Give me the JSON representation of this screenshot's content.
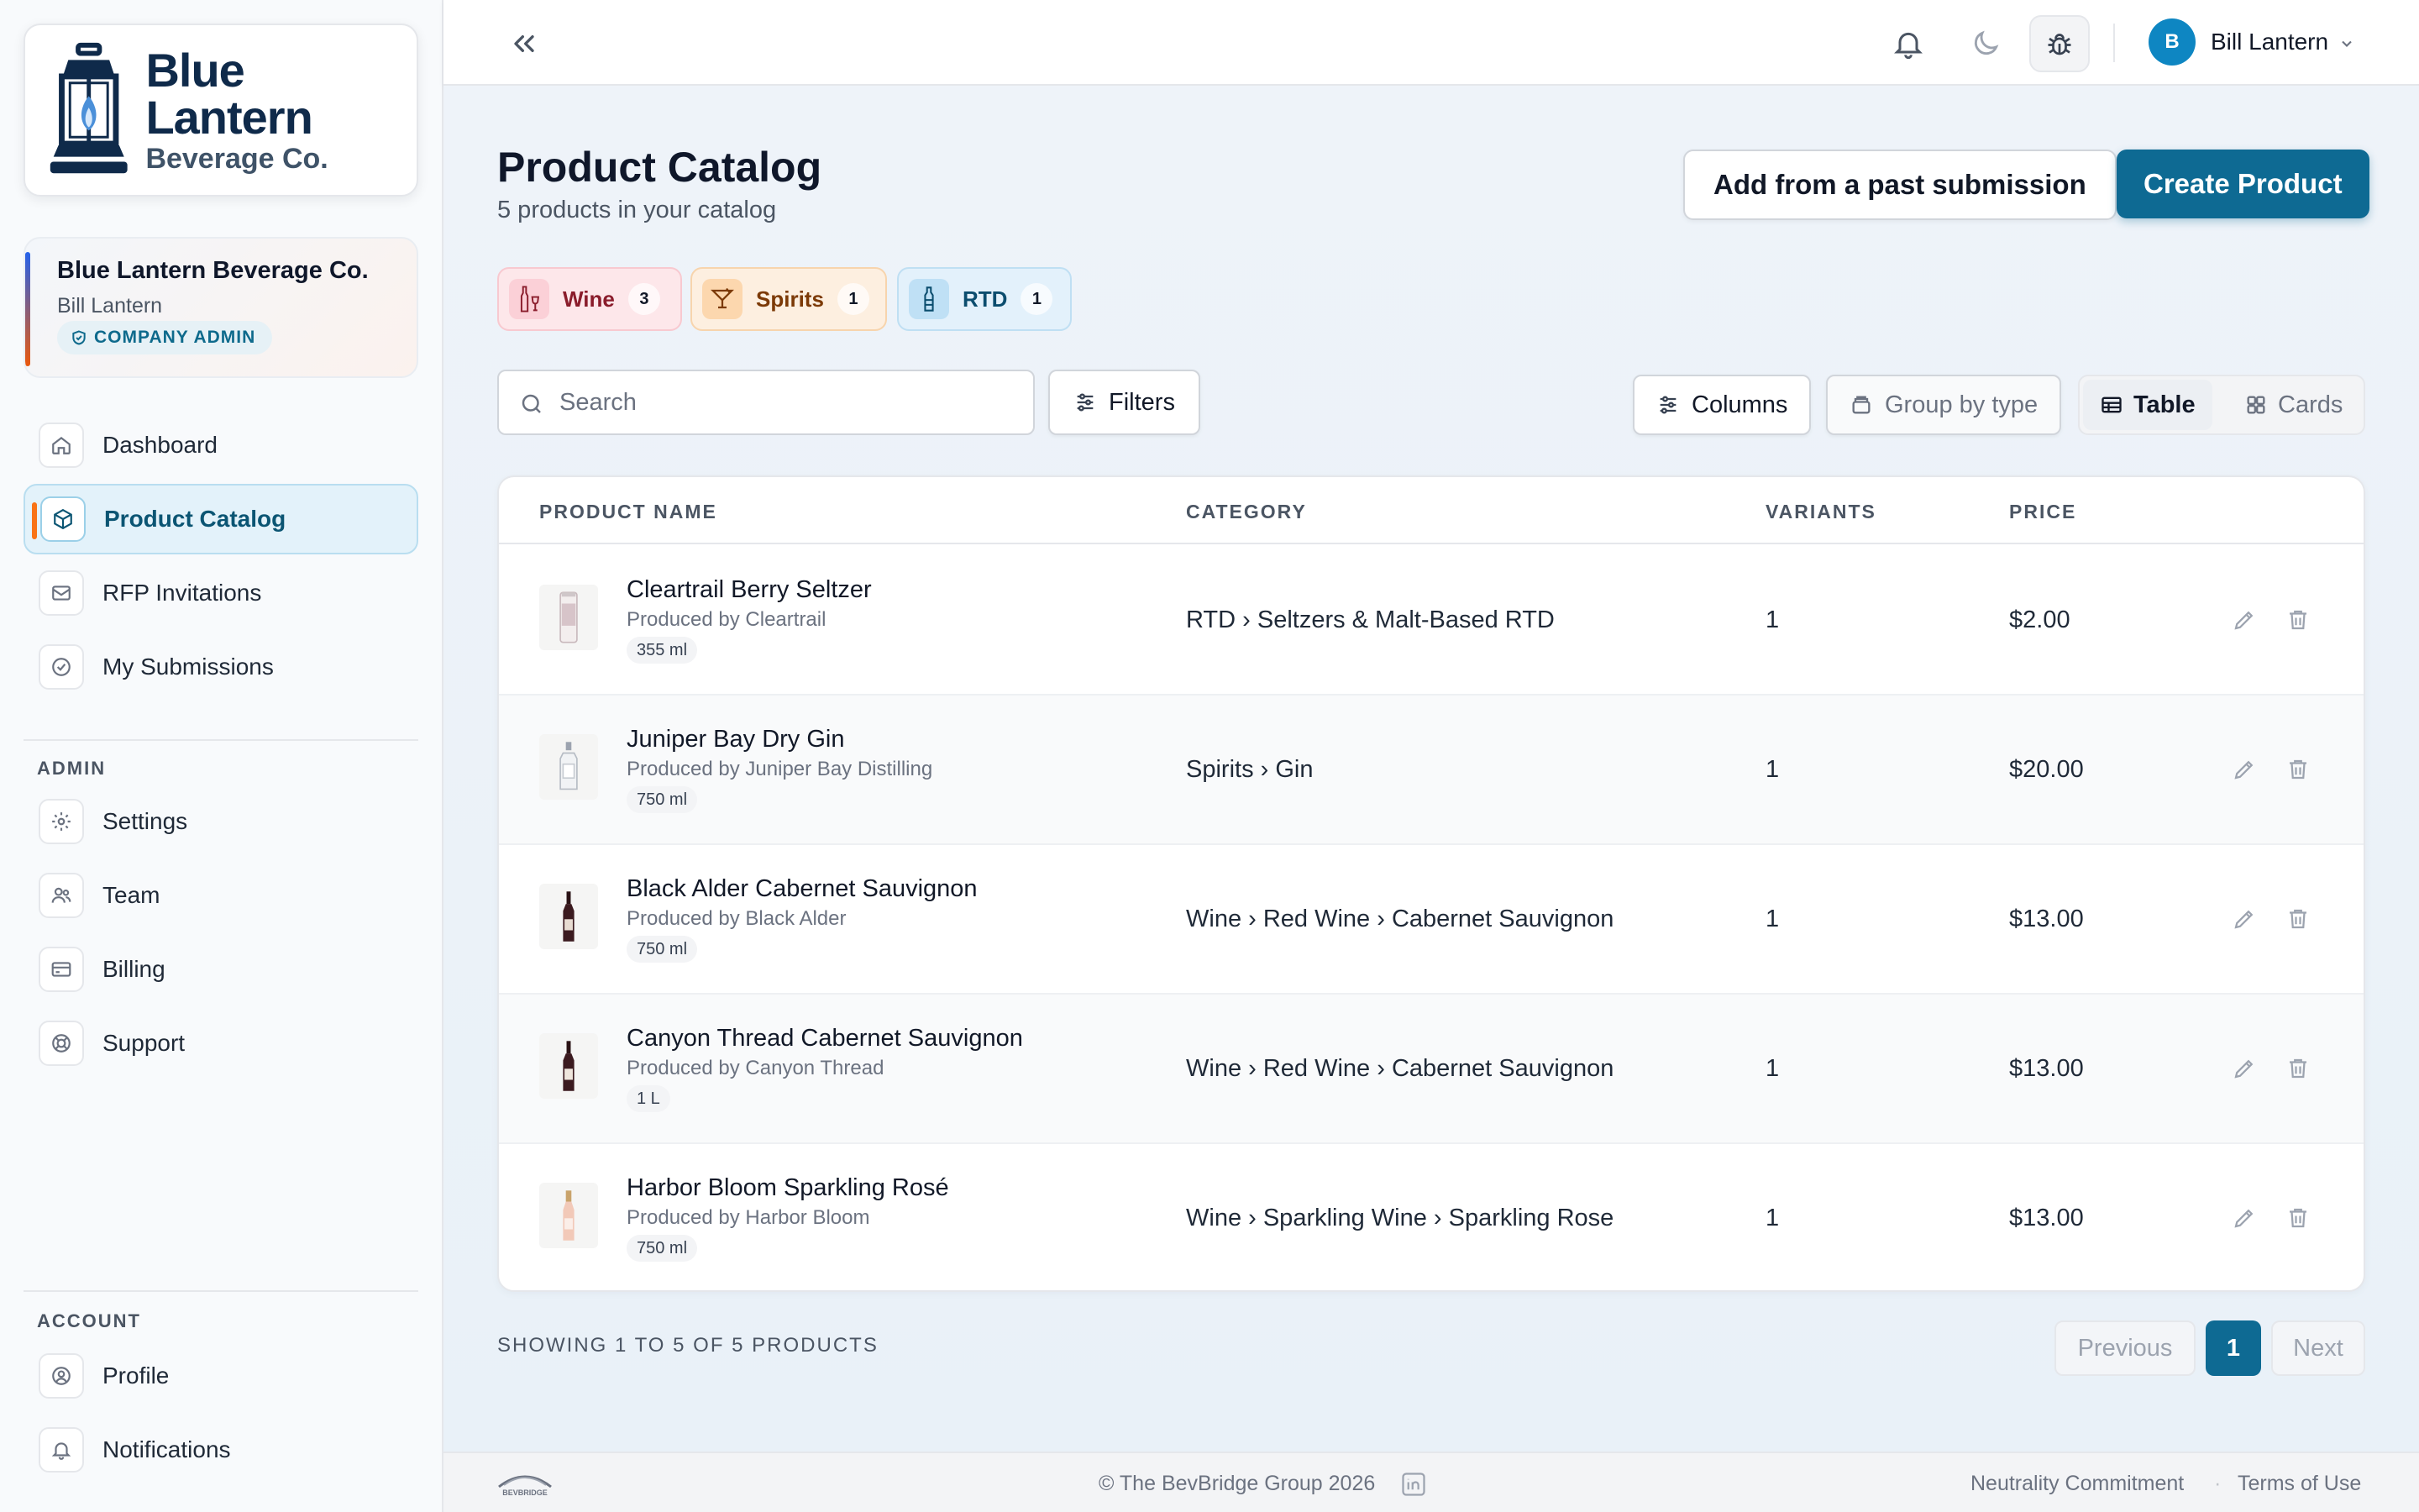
{
  "brand": {
    "name_line1": "Blue Lantern",
    "name_line2": "Beverage Co."
  },
  "company": {
    "name": "Blue Lantern Beverage Co.",
    "user": "Bill Lantern",
    "role_badge": "COMPANY ADMIN"
  },
  "sidebar": {
    "main_items": [
      {
        "label": "Dashboard",
        "icon": "home-icon"
      },
      {
        "label": "Product Catalog",
        "icon": "box-icon",
        "active": true
      },
      {
        "label": "RFP Invitations",
        "icon": "mail-icon"
      },
      {
        "label": "My Submissions",
        "icon": "check-circle-icon"
      }
    ],
    "admin_label": "ADMIN",
    "admin_items": [
      {
        "label": "Settings",
        "icon": "gear-icon"
      },
      {
        "label": "Team",
        "icon": "users-icon"
      },
      {
        "label": "Billing",
        "icon": "credit-card-icon"
      },
      {
        "label": "Support",
        "icon": "lifebuoy-icon"
      }
    ],
    "account_label": "ACCOUNT",
    "account_items": [
      {
        "label": "Profile",
        "icon": "user-circle-icon"
      },
      {
        "label": "Notifications",
        "icon": "bell-icon"
      }
    ]
  },
  "topbar": {
    "user_initial": "B",
    "user_name": "Bill Lantern"
  },
  "page": {
    "title": "Product Catalog",
    "subtitle": "5 products in your catalog",
    "add_past_label": "Add from a past submission",
    "create_label": "Create Product"
  },
  "chips": [
    {
      "label": "Wine",
      "count": "3",
      "bg": "#fde7ea",
      "border": "#f8c9d0",
      "icon_bg": "#fbd0d7",
      "color": "#8a1c2b"
    },
    {
      "label": "Spirits",
      "count": "1",
      "bg": "#fdefe0",
      "border": "#f7d4ad",
      "icon_bg": "#fcd7ae",
      "color": "#7c3a07"
    },
    {
      "label": "RTD",
      "count": "1",
      "bg": "#e3f1fb",
      "border": "#bfdff3",
      "icon_bg": "#bfe0f5",
      "color": "#0b4d6e"
    }
  ],
  "toolbar": {
    "search_placeholder": "Search",
    "filters_label": "Filters",
    "columns_label": "Columns",
    "group_label": "Group by type",
    "table_label": "Table",
    "cards_label": "Cards"
  },
  "table": {
    "headers": [
      "PRODUCT NAME",
      "CATEGORY",
      "VARIANTS",
      "PRICE"
    ],
    "rows": [
      {
        "name": "Cleartrail Berry Seltzer",
        "producer": "Produced by Cleartrail",
        "size": "355 ml",
        "category": "RTD › Seltzers & Malt-Based RTD",
        "variants": "1",
        "price": "$2.00",
        "thumb": "can"
      },
      {
        "name": "Juniper Bay Dry Gin",
        "producer": "Produced by Juniper Bay Distilling",
        "size": "750 ml",
        "category": "Spirits › Gin",
        "variants": "1",
        "price": "$20.00",
        "thumb": "gin"
      },
      {
        "name": "Black Alder Cabernet Sauvignon",
        "producer": "Produced by Black Alder",
        "size": "750 ml",
        "category": "Wine › Red Wine › Cabernet Sauvignon",
        "variants": "1",
        "price": "$13.00",
        "thumb": "red"
      },
      {
        "name": "Canyon Thread Cabernet Sauvignon",
        "producer": "Produced by Canyon Thread",
        "size": "1 L",
        "category": "Wine › Red Wine › Cabernet Sauvignon",
        "variants": "1",
        "price": "$13.00",
        "thumb": "red"
      },
      {
        "name": "Harbor Bloom Sparkling Rosé",
        "producer": "Produced by Harbor Bloom",
        "size": "750 ml",
        "category": "Wine › Sparkling Wine › Sparkling Rose",
        "variants": "1",
        "price": "$13.00",
        "thumb": "rose"
      }
    ]
  },
  "pagination": {
    "showing": "SHOWING 1 TO 5 OF 5 PRODUCTS",
    "previous": "Previous",
    "current": "1",
    "next": "Next"
  },
  "footer": {
    "logo_text": "BEVBRIDGE",
    "copyright": "© The BevBridge Group 2026",
    "neutrality": "Neutrality Commitment",
    "separator": "·",
    "terms": "Terms of Use"
  }
}
